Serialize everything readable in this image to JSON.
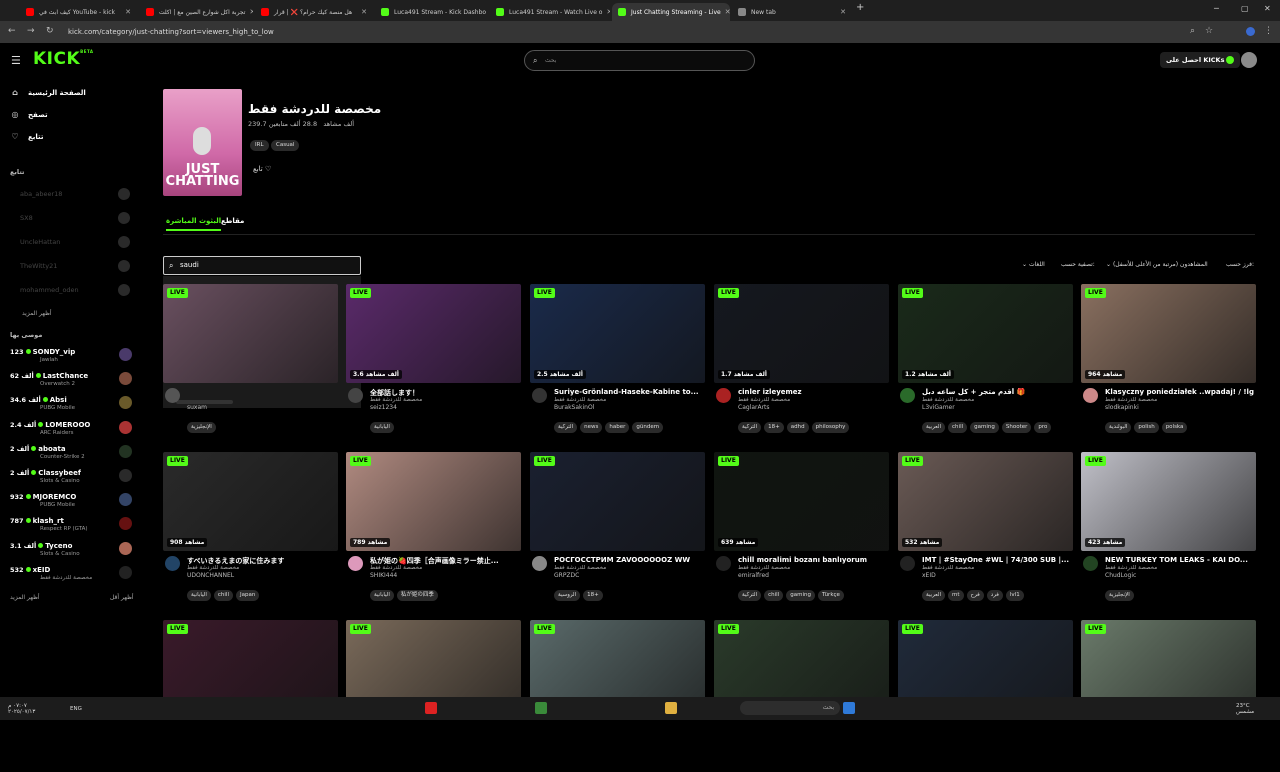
{
  "browser": {
    "tabs": [
      {
        "label": "كيف ابث في YouTube - kick",
        "color": "#ff0000"
      },
      {
        "label": "تجربة اكل شوارع الصين مع | اكلت",
        "color": "#ff0000"
      },
      {
        "label": "هل منصة كيك حرام؟ ❌ | قرار",
        "color": "#ff0000"
      },
      {
        "label": "Luca491 Stream - Kick Dashbo",
        "color": "#53fc18"
      },
      {
        "label": "Luca491 Stream - Watch Live o",
        "color": "#53fc18"
      },
      {
        "label": "Just Chatting Streaming - Live",
        "color": "#53fc18"
      },
      {
        "label": "New tab",
        "color": "#888888"
      }
    ],
    "url": "kick.com/category/just-chatting?sort=viewers_high_to_low"
  },
  "header": {
    "logo": "KICK",
    "logo_sup": "BETA",
    "search_placeholder": "بحث",
    "get_kicks": "احصل على KICKs"
  },
  "sidebar": {
    "nav": [
      {
        "label": "الصفحة الرئيسية",
        "icon": "home-icon",
        "glyph": "⌂"
      },
      {
        "label": "تصفح",
        "icon": "compass-icon",
        "glyph": "◎"
      },
      {
        "label": "تتابع",
        "icon": "heart-icon",
        "glyph": "♡"
      }
    ],
    "following_title": "تتابع",
    "following": [
      {
        "name": "aba_abeer18"
      },
      {
        "name": "SX8"
      },
      {
        "name": "UncleHattan"
      },
      {
        "name": "TheWitty21"
      },
      {
        "name": "mohammed_oden"
      }
    ],
    "show_more": "أظهر المزيد",
    "recommended_title": "موصى بها",
    "recommended": [
      {
        "count": "123",
        "name": "SONDY_vip",
        "category": "Jawlah",
        "color": "#4a3a6a"
      },
      {
        "count": "62 ألف",
        "name": "LastChance",
        "category": "Overwatch 2",
        "color": "#7a4a3a"
      },
      {
        "count": "34.6 ألف",
        "name": "Absi",
        "category": "PUBG Mobile",
        "color": "#6a5a2a"
      },
      {
        "count": "2.4 ألف",
        "name": "LOMEROOO",
        "category": "ARC Raiders",
        "color": "#aa3333"
      },
      {
        "count": "2 ألف",
        "name": "aboata",
        "category": "Counter-Strike 2",
        "color": "#223322"
      },
      {
        "count": "2 ألف",
        "name": "Classybeef",
        "category": "Slots & Casino",
        "color": "#2a2a2a"
      },
      {
        "count": "932",
        "name": "MJOREMCO",
        "category": "PUBG Mobile",
        "color": "#334466"
      },
      {
        "count": "787",
        "name": "klash_rt",
        "category": "Respect RP (GTA)",
        "color": "#661111"
      },
      {
        "count": "3.1 ألف",
        "name": "Tyceno",
        "category": "Slots & Casino",
        "color": "#aa6655"
      },
      {
        "count": "532",
        "name": "xEID",
        "category": "مخصصة للدردشة فقط",
        "color": "#222222"
      }
    ],
    "show_more_2": "أظهر المزيد",
    "show_less": "أظهر أقل"
  },
  "category": {
    "title": "مخصصة للدردشة فقط",
    "viewers": "239.7 ألف مشاهد",
    "followers": "28.8 ألف متابعين",
    "tags": [
      "IRL",
      "Casual"
    ],
    "follow": "تابع",
    "image_text": "JUST CHATTING",
    "tab_live": "البثوث المباشرة",
    "tab_clips": "مقاطع"
  },
  "filters": {
    "language_search_value": "saudi",
    "languages_label": "اللغات",
    "filter_label": "تصفية حسب:",
    "sort_value": "المشاهدون (مرتبة من الأعلى للأسفل)",
    "sort_label": "فرز حسب:"
  },
  "streams": [
    {
      "viewers": "",
      "title": "",
      "category": "",
      "streamer": "suxam",
      "chips": [
        "الإنجليزية"
      ],
      "bg": "#6a5060",
      "avatar": "#555555"
    },
    {
      "viewers": "3.6 ألف مشاهد",
      "title": "全部話します！",
      "category": "مخصصة للدردشة فقط",
      "streamer": "seiz1234",
      "chips": [
        "اليابانية"
      ],
      "bg": "#5a2a6a",
      "avatar": "#444444"
    },
    {
      "viewers": "2.5 ألف مشاهد",
      "title": "Suriye-Grönland-Haseke-Kabine to...",
      "category": "مخصصة للدردشة فقط",
      "streamer": "BurakSakinOl",
      "chips": [
        "التركية",
        "news",
        "haber",
        "gündem"
      ],
      "bg": "#1a2a4a",
      "avatar": "#333333"
    },
    {
      "viewers": "1.7 ألف مشاهد",
      "title": "cinler izleyemez",
      "category": "مخصصة للدردشة فقط",
      "streamer": "CaglarArts",
      "chips": [
        "التركية",
        "18+",
        "adhd",
        "philosophy"
      ],
      "bg": "#15181f",
      "avatar": "#aa2222"
    },
    {
      "viewers": "1.2 ألف مشاهد",
      "title": "أقدم متجر + كل ساعه دبل 🎁",
      "category": "مخصصة للدردشة فقط",
      "streamer": "L3viGamer",
      "chips": [
        "العربية",
        "chill",
        "gaming",
        "Shooter",
        "pro"
      ],
      "bg": "#1a2a1a",
      "avatar": "#2a6a2a"
    },
    {
      "viewers": "964 مشاهد",
      "title": "Klasyczny poniedziałek ..wpadaj! / !lg",
      "category": "مخصصة للدردشة فقط",
      "streamer": "slodkapinki",
      "chips": [
        "البولندية",
        "polish",
        "polska"
      ],
      "bg": "#8a7060",
      "avatar": "#cc8888"
    },
    {
      "viewers": "908 مشاهد",
      "title": "すべいきるえまの家に住みます",
      "category": "مخصصة للدردشة فقط",
      "streamer": "UDONCHANNEL",
      "chips": [
        "اليابانية",
        "chill",
        "Japan"
      ],
      "bg": "#2a2a2a",
      "avatar": "#224466"
    },
    {
      "viewers": "789 مشاهد",
      "title": "私が姫の🍓四季［合声画像ミラー禁止...",
      "category": "مخصصة للدردشة فقط",
      "streamer": "SHIKI444",
      "chips": [
        "اليابانية",
        "私が姫の四季"
      ],
      "bg": "#b08a80",
      "avatar": "#dd99bb"
    },
    {
      "viewers": "",
      "title": "РОСГОССТРИМ ZAVOOOOOOZ WW",
      "category": "مخصصة للدردشة فقط",
      "streamer": "GRPZDC",
      "chips": [
        "الروسية",
        "18+"
      ],
      "bg": "#1a2030",
      "avatar": "#888888"
    },
    {
      "viewers": "639 مشاهد",
      "title": "chill moralimi bozanı banlıyorum",
      "category": "مخصصة للدردشة فقط",
      "streamer": "emiralfred",
      "chips": [
        "التركية",
        "chill",
        "gaming",
        "Türkçe"
      ],
      "bg": "#101510",
      "avatar": "#222222"
    },
    {
      "viewers": "532 مشاهد",
      "title": "IMT | #StayOne #WL | 74/300 SUB |...",
      "category": "مخصصة للدردشة فقط",
      "streamer": "xEID",
      "chips": [
        "العربية",
        "mt",
        "فرح",
        "فرد",
        "lvl1"
      ],
      "bg": "#6a5a55",
      "avatar": "#222222"
    },
    {
      "viewers": "423 مشاهد",
      "title": "NEW TURKEY TOM LEAKS - KAI DO...",
      "category": "مخصصة للدردشة فقط",
      "streamer": "ChudLogic",
      "chips": [
        "الإنجليزية"
      ],
      "bg": "#c0c0c8",
      "avatar": "#224422"
    },
    {
      "viewers": "",
      "title": "",
      "category": "",
      "streamer": "",
      "chips": [],
      "bg": "#3a1a2a",
      "avatar": "#333333"
    },
    {
      "viewers": "",
      "title": "",
      "category": "",
      "streamer": "",
      "chips": [],
      "bg": "#7a6a5a",
      "avatar": "#333333"
    },
    {
      "viewers": "",
      "title": "",
      "category": "",
      "streamer": "",
      "chips": [],
      "bg": "#5a6a6a",
      "avatar": "#333333"
    },
    {
      "viewers": "",
      "title": "",
      "category": "",
      "streamer": "",
      "chips": [],
      "bg": "#2a3a2a",
      "avatar": "#333333"
    },
    {
      "viewers": "",
      "title": "",
      "category": "",
      "streamer": "",
      "chips": [],
      "bg": "#202a3a",
      "avatar": "#333333"
    },
    {
      "viewers": "",
      "title": "",
      "category": "",
      "streamer": "",
      "chips": [],
      "bg": "#6a7a6a",
      "avatar": "#333333"
    }
  ],
  "live_badge": "LIVE",
  "taskbar": {
    "time": "٠٧:٠٧ م",
    "date": "٢٠٢٥/٠٧/١٣",
    "lang": "ENG",
    "search": "بحث",
    "weather": "23°C",
    "weather_desc": "مشمس"
  },
  "colors": {
    "accent": "#53fc18",
    "background": "#000000"
  }
}
